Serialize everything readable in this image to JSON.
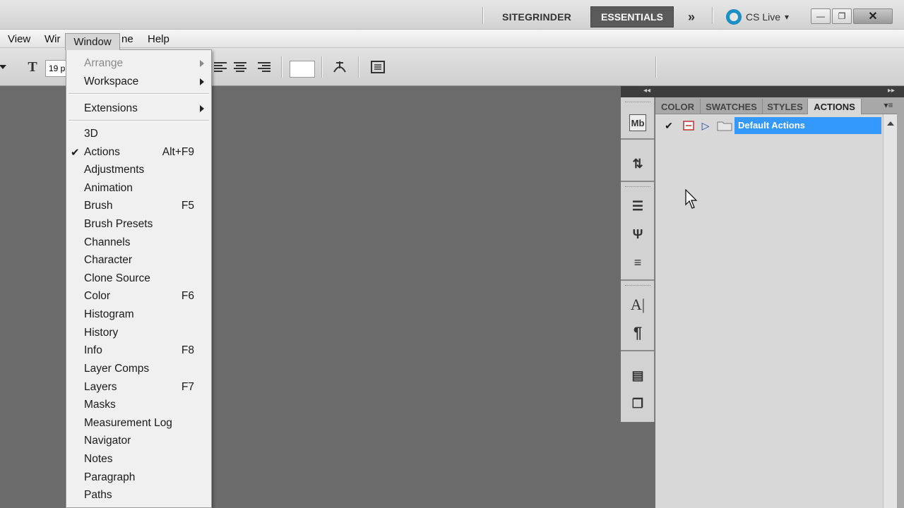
{
  "titlebar": {
    "workspace_sitegrinder": "SITEGRINDER",
    "workspace_essentials": "ESSENTIALS",
    "more_glyph": "»",
    "cslive_label": "CS Live",
    "cslive_arrow": "▾",
    "min_glyph": "—",
    "max_glyph": "❐",
    "close_glyph": "✕"
  },
  "menubar": {
    "view": "View",
    "window_partial": "Wir",
    "window_active": "Window",
    "help_partial": "ne",
    "help": "Help"
  },
  "options": {
    "font_size": "19 p",
    "text_tool_glyph": "T"
  },
  "window_menu": {
    "arrange": "Arrange",
    "workspace": "Workspace",
    "extensions": "Extensions",
    "items": [
      {
        "label": "3D",
        "shortcut": ""
      },
      {
        "label": "Actions",
        "shortcut": "Alt+F9",
        "checked": "✔"
      },
      {
        "label": "Adjustments",
        "shortcut": ""
      },
      {
        "label": "Animation",
        "shortcut": ""
      },
      {
        "label": "Brush",
        "shortcut": "F5"
      },
      {
        "label": "Brush Presets",
        "shortcut": ""
      },
      {
        "label": "Channels",
        "shortcut": ""
      },
      {
        "label": "Character",
        "shortcut": ""
      },
      {
        "label": "Clone Source",
        "shortcut": ""
      },
      {
        "label": "Color",
        "shortcut": "F6"
      },
      {
        "label": "Histogram",
        "shortcut": ""
      },
      {
        "label": "History",
        "shortcut": ""
      },
      {
        "label": "Info",
        "shortcut": "F8"
      },
      {
        "label": "Layer Comps",
        "shortcut": ""
      },
      {
        "label": "Layers",
        "shortcut": "F7"
      },
      {
        "label": "Masks",
        "shortcut": ""
      },
      {
        "label": "Measurement Log",
        "shortcut": ""
      },
      {
        "label": "Navigator",
        "shortcut": ""
      },
      {
        "label": "Notes",
        "shortcut": ""
      },
      {
        "label": "Paragraph",
        "shortcut": ""
      },
      {
        "label": "Paths",
        "shortcut": ""
      }
    ]
  },
  "panel": {
    "tabs": [
      "COLOR",
      "SWATCHES",
      "STYLES",
      "ACTIONS"
    ],
    "active_tab": "ACTIONS",
    "menu_glyph": "▾≡",
    "check_glyph": "✔",
    "expand_glyph": "▷",
    "action_set": "Default Actions"
  },
  "dock": {
    "collapse_left": "◂◂",
    "collapse_right": "▸▸",
    "icons": [
      "Mb",
      "⇅",
      "☰",
      "Ψ",
      "≡",
      "A|",
      "¶",
      "▤",
      "❐"
    ]
  },
  "colors": {
    "accent_selection": "#3399ff",
    "canvas": "#6c6c6c",
    "essentials_bg": "#5a5a5a",
    "cslive_ring": "#1a8fc4"
  }
}
